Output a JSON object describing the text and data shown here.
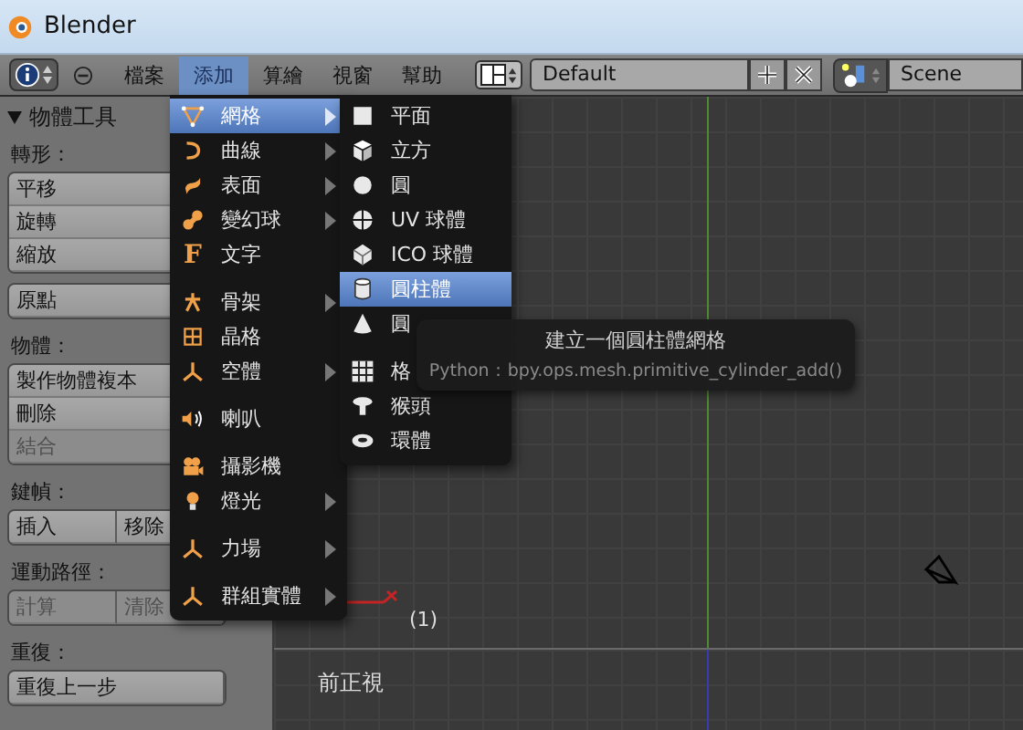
{
  "window": {
    "title": "Blender"
  },
  "header": {
    "menus": [
      {
        "label": "檔案",
        "selected": false
      },
      {
        "label": "添加",
        "selected": true
      },
      {
        "label": "算繪",
        "selected": false
      },
      {
        "label": "視窗",
        "selected": false
      },
      {
        "label": "幫助",
        "selected": false
      }
    ],
    "layout": "Default",
    "scene": "Scene"
  },
  "tool_panel": {
    "title": "物體工具",
    "expanded": true,
    "sections": [
      {
        "label": "轉形：",
        "rows": [
          [
            {
              "label": "平移",
              "disabled": false
            }
          ],
          [
            {
              "label": "旋轉",
              "disabled": false
            }
          ],
          [
            {
              "label": "縮放",
              "disabled": false
            }
          ]
        ]
      },
      {
        "rows": [
          [
            {
              "label": "原點",
              "disabled": false
            }
          ]
        ]
      },
      {
        "label": "物體：",
        "rows": [
          [
            {
              "label": "製作物體複本",
              "disabled": false
            }
          ],
          [
            {
              "label": "刪除",
              "disabled": false
            }
          ],
          [
            {
              "label": "結合",
              "disabled": true
            }
          ]
        ]
      },
      {
        "label": "鍵幀：",
        "rows": [
          [
            {
              "label": "插入",
              "disabled": false
            },
            {
              "label": "移除",
              "disabled": false
            }
          ]
        ]
      },
      {
        "label": "運動路徑：",
        "rows": [
          [
            {
              "label": "計算",
              "disabled": true
            },
            {
              "label": "清除",
              "disabled": true
            }
          ]
        ]
      },
      {
        "label": "重復：",
        "rows": [
          [
            {
              "label": "重復上一步",
              "disabled": false
            }
          ]
        ]
      }
    ]
  },
  "add_menu": {
    "groups": [
      [
        {
          "label": "網格",
          "submenu": true,
          "selected": true
        },
        {
          "label": "曲線",
          "submenu": true,
          "selected": false
        },
        {
          "label": "表面",
          "submenu": true,
          "selected": false
        },
        {
          "label": "變幻球",
          "submenu": true,
          "selected": false
        },
        {
          "label": "文字",
          "submenu": false,
          "selected": false,
          "glyph": "F"
        }
      ],
      [
        {
          "label": "骨架",
          "submenu": true,
          "selected": false
        },
        {
          "label": "晶格",
          "submenu": false,
          "selected": false
        },
        {
          "label": "空體",
          "submenu": true,
          "selected": false
        }
      ],
      [
        {
          "label": "喇叭",
          "submenu": false,
          "selected": false
        }
      ],
      [
        {
          "label": "攝影機",
          "submenu": false,
          "selected": false
        },
        {
          "label": "燈光",
          "submenu": true,
          "selected": false
        }
      ],
      [
        {
          "label": "力場",
          "submenu": true,
          "selected": false
        }
      ],
      [
        {
          "label": "群組實體",
          "submenu": true,
          "selected": false
        }
      ]
    ]
  },
  "mesh_menu": {
    "groups": [
      [
        {
          "label": "平面",
          "selected": false
        },
        {
          "label": "立方",
          "selected": false
        },
        {
          "label": "圓",
          "selected": false
        },
        {
          "label": "UV 球體",
          "selected": false
        },
        {
          "label": "ICO 球體",
          "selected": false
        },
        {
          "label": "圓柱體",
          "selected": true
        },
        {
          "label": "圓",
          "selected": false
        }
      ],
      [
        {
          "label": "格",
          "selected": false
        },
        {
          "label": "猴頭",
          "selected": false
        },
        {
          "label": "環體",
          "selected": false
        }
      ]
    ]
  },
  "tooltip": {
    "title": "建立一個圓柱體網格",
    "python": "Python：bpy.ops.mesh.primitive_cylinder_add()"
  },
  "viewport": {
    "frame": "(1)",
    "view_name": "前正視"
  }
}
